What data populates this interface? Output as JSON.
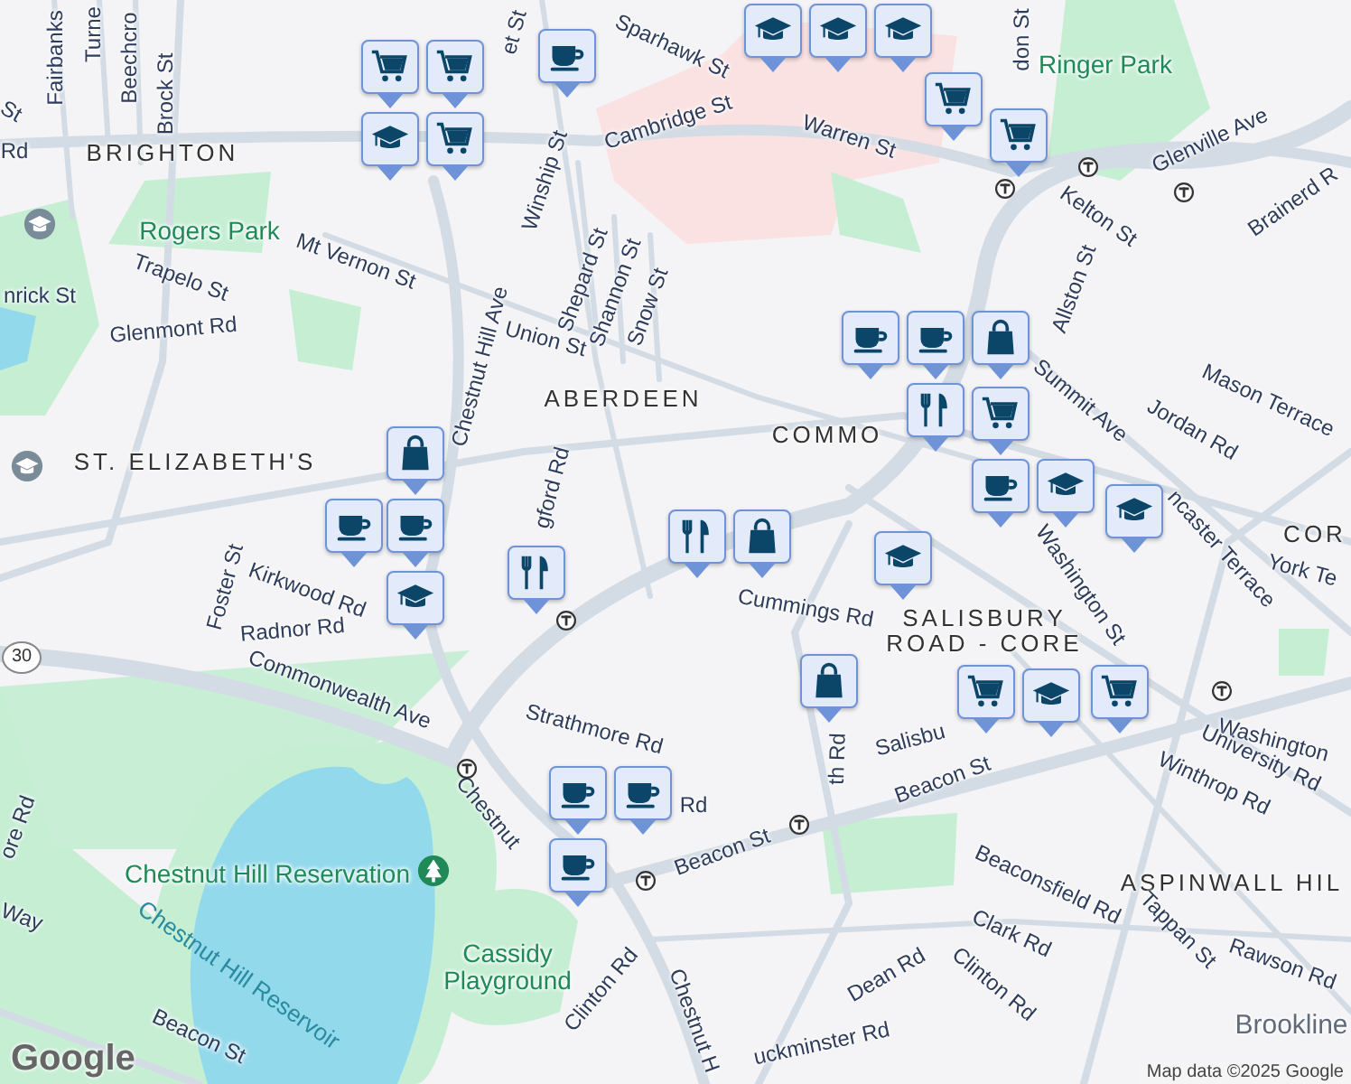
{
  "map": {
    "labels": [
      {
        "text": "Fairbanks",
        "kind": "street"
      },
      {
        "text": "Turne",
        "kind": "street"
      },
      {
        "text": "Beechcro",
        "kind": "street"
      },
      {
        "text": "Brock St",
        "kind": "street"
      },
      {
        "text": "et St",
        "kind": "street"
      },
      {
        "text": "Sparhawk St",
        "kind": "street"
      },
      {
        "text": "Cambridge St",
        "kind": "street"
      },
      {
        "text": "don St",
        "kind": "street"
      },
      {
        "text": "Ringer Park",
        "kind": "park"
      },
      {
        "text": "Warren St",
        "kind": "street"
      },
      {
        "text": "Glenville Ave",
        "kind": "street"
      },
      {
        "text": "BRIGHTON",
        "kind": "area"
      },
      {
        "text": "Kelton St",
        "kind": "street"
      },
      {
        "text": "Brainerd R",
        "kind": "street"
      },
      {
        "text": "Winship St",
        "kind": "street"
      },
      {
        "text": "Rogers Park",
        "kind": "park"
      },
      {
        "text": "Mt Vernon St",
        "kind": "street"
      },
      {
        "text": "Allston St",
        "kind": "street"
      },
      {
        "text": "Shepard St",
        "kind": "street"
      },
      {
        "text": "Shannon St",
        "kind": "street"
      },
      {
        "text": "Snow St",
        "kind": "street"
      },
      {
        "text": "Trapelo St",
        "kind": "street"
      },
      {
        "text": "nrick St",
        "kind": "street"
      },
      {
        "text": "Glenmont Rd",
        "kind": "street"
      },
      {
        "text": "Union St",
        "kind": "street"
      },
      {
        "text": "Summit Ave",
        "kind": "street"
      },
      {
        "text": "ABERDEEN",
        "kind": "area"
      },
      {
        "text": "Mason Terrace",
        "kind": "street"
      },
      {
        "text": "Jordan Rd",
        "kind": "street"
      },
      {
        "text": "COMMO",
        "kind": "area"
      },
      {
        "text": "Chestnut Hill Ave",
        "kind": "street"
      },
      {
        "text": "ST. ELIZABETH'S",
        "kind": "area"
      },
      {
        "text": "Washington St",
        "kind": "street"
      },
      {
        "text": "ncaster Terrace",
        "kind": "street"
      },
      {
        "text": "COR",
        "kind": "area"
      },
      {
        "text": "gford Rd",
        "kind": "street"
      },
      {
        "text": "York Te",
        "kind": "street"
      },
      {
        "text": "Foster St",
        "kind": "street"
      },
      {
        "text": "Kirkwood Rd",
        "kind": "street"
      },
      {
        "text": "Radnor Rd",
        "kind": "street"
      },
      {
        "text": "SALISBURY ROAD - CORE",
        "kind": "area"
      },
      {
        "text": "Cummings Rd",
        "kind": "street"
      },
      {
        "text": "30",
        "kind": "route"
      },
      {
        "text": "Commonwealth Ave",
        "kind": "street"
      },
      {
        "text": "Salisbu",
        "kind": "street"
      },
      {
        "text": "Strathmore Rd",
        "kind": "street"
      },
      {
        "text": "th Rd",
        "kind": "street"
      },
      {
        "text": "Washington",
        "kind": "street"
      },
      {
        "text": "University Rd",
        "kind": "street"
      },
      {
        "text": "Beacon St",
        "kind": "street"
      },
      {
        "text": "Winthrop Rd",
        "kind": "street"
      },
      {
        "text": "Chestnut",
        "kind": "street"
      },
      {
        "text": "Rd",
        "kind": "street"
      },
      {
        "text": "Beacon St",
        "kind": "street"
      },
      {
        "text": "Chestnut Hill Reservation",
        "kind": "park"
      },
      {
        "text": "ASPINWALL HIL",
        "kind": "area"
      },
      {
        "text": "Beaconsfield Rd",
        "kind": "street"
      },
      {
        "text": "Cassidy Playground",
        "kind": "park"
      },
      {
        "text": "Clark Rd",
        "kind": "street"
      },
      {
        "text": "Tappan St",
        "kind": "street"
      },
      {
        "text": "Chestnut Hill Reservoir",
        "kind": "water"
      },
      {
        "text": "Rawson Rd",
        "kind": "street"
      },
      {
        "text": "Dean Rd",
        "kind": "street"
      },
      {
        "text": "Clinton Rd",
        "kind": "street"
      },
      {
        "text": "Clinton Rd",
        "kind": "street"
      },
      {
        "text": "Brookline",
        "kind": "town"
      },
      {
        "text": "Chestnut H",
        "kind": "street"
      },
      {
        "text": "uckminster Rd",
        "kind": "street"
      },
      {
        "text": "Beacon St",
        "kind": "street"
      },
      {
        "text": "ore Rd",
        "kind": "street"
      },
      {
        "text": "Way",
        "kind": "street"
      },
      {
        "text": "St",
        "kind": "street"
      },
      {
        "text": "Rd",
        "kind": "street"
      }
    ],
    "pins": [
      {
        "kind": "school"
      },
      {
        "kind": "school"
      },
      {
        "kind": "school"
      },
      {
        "kind": "cafe"
      },
      {
        "kind": "grocery"
      },
      {
        "kind": "grocery"
      },
      {
        "kind": "grocery"
      },
      {
        "kind": "school"
      },
      {
        "kind": "grocery"
      },
      {
        "kind": "grocery"
      },
      {
        "kind": "cafe"
      },
      {
        "kind": "cafe"
      },
      {
        "kind": "shopping"
      },
      {
        "kind": "restaurant"
      },
      {
        "kind": "grocery"
      },
      {
        "kind": "cafe"
      },
      {
        "kind": "school"
      },
      {
        "kind": "shopping"
      },
      {
        "kind": "cafe"
      },
      {
        "kind": "cafe"
      },
      {
        "kind": "school"
      },
      {
        "kind": "restaurant"
      },
      {
        "kind": "restaurant"
      },
      {
        "kind": "shopping"
      },
      {
        "kind": "school"
      },
      {
        "kind": "school"
      },
      {
        "kind": "shopping"
      },
      {
        "kind": "school"
      },
      {
        "kind": "grocery"
      },
      {
        "kind": "grocery"
      },
      {
        "kind": "cafe"
      },
      {
        "kind": "cafe"
      },
      {
        "kind": "cafe"
      }
    ],
    "logo": "Google",
    "attribution": "Map data ©2025 Google"
  }
}
